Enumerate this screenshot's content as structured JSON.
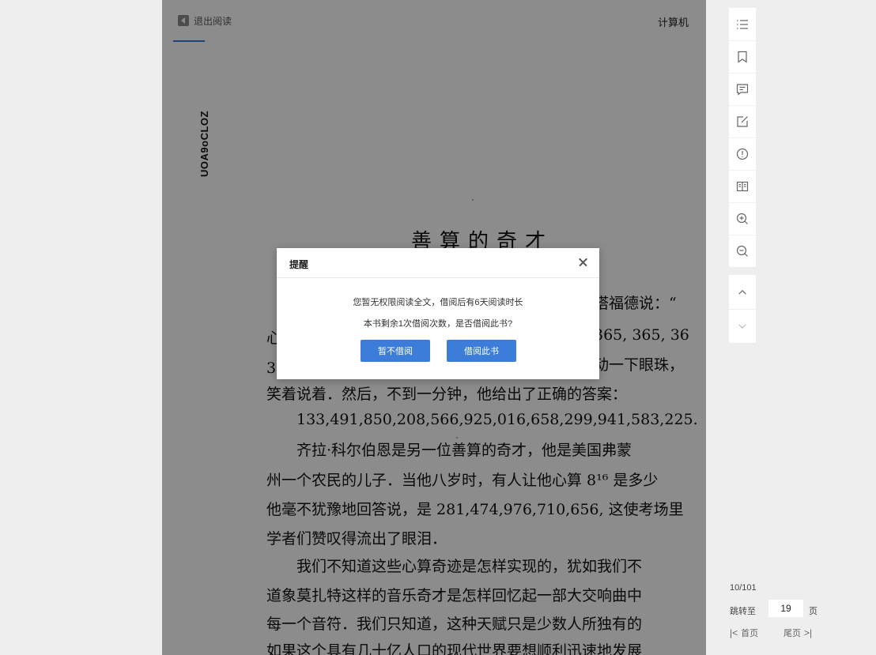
{
  "reader": {
    "exit_label": "退出阅读",
    "book_title": "计算机",
    "watermark": "UOA9oCLOZ",
    "chapter_title": "善算的奇才",
    "lines": [
      "塔福德说：“",
      "心",
      "365, 365, 36",
      "3",
      "动一下眼珠，",
      "笑着说着．然后，不到一分钟，他给出了正确的答案：",
      "133,491,850,208,566,925,016,658,299,941,583,225.",
      "齐拉·科尔伯恩是另一位善算的奇才，他是美国弗蒙",
      "州一个农民的儿子．当他八岁时，有人让他心算 8¹⁶ 是多少",
      "他毫不犹豫地回答说，是 281,474,976,710,656, 这使考场里",
      "学者们赞叹得流出了眼泪．",
      "我们不知道这些心算奇迹是怎样实现的，犹如我们不",
      "道象莫扎特这样的音乐奇才是怎样回忆起一部大交响曲中",
      "每一个音符．我们只知道，这种天赋只是少数人所独有的",
      "如果这个具有几十亿人口的现代世界要想顺利迅速地发展"
    ]
  },
  "dialog": {
    "title": "提醒",
    "message_1": "您暂无权限阅读全文，借阅后有6天阅读时长",
    "message_2": "本书剩余1次借阅次数，是否借阅此书?",
    "cancel_label": "暂不借阅",
    "confirm_label": "借阅此书"
  },
  "toolbar": {
    "tools": [
      "catalog-icon",
      "bookmark-icon",
      "comment-icon",
      "note-edit-icon",
      "report-icon",
      "book-view-icon",
      "zoom-in-icon",
      "zoom-out-icon"
    ],
    "nav": [
      "chevron-up-icon",
      "chevron-down-icon"
    ]
  },
  "pager": {
    "page_count": "10/101",
    "jump_label": "跳转至",
    "jump_value": "19",
    "page_unit": "页",
    "first_label": "首页",
    "last_label": "尾页"
  },
  "colors": {
    "accent": "#3b7dd8",
    "mask": "rgba(0,0,0,0.45)",
    "background": "#eeeeee"
  }
}
